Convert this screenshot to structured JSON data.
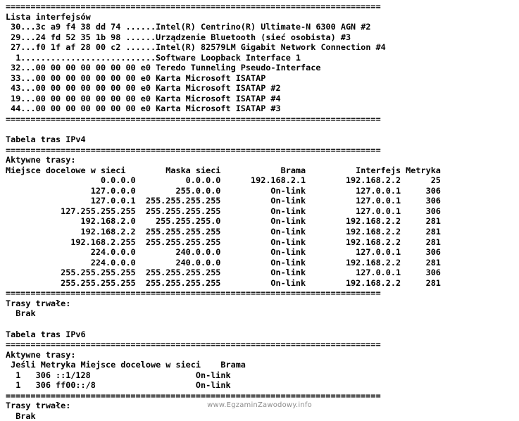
{
  "window": {
    "title": "route print",
    "background_color": "#ffffff",
    "text_color": "#000000"
  },
  "separator": "===========================================================================",
  "interface_list": {
    "heading": "Lista interfejsów",
    "rows": [
      {
        "id": "30",
        "mac": "...3c a9 f4 38 dd 74 ......",
        "name": "Intel(R) Centrino(R) Ultimate-N 6300 AGN #2"
      },
      {
        "id": "29",
        "mac": "...24 fd 52 35 1b 98 ......",
        "name": "Urządzenie Bluetooth (sieć osobista) #3"
      },
      {
        "id": "27",
        "mac": "...f0 1f af 28 00 c2 ......",
        "name": "Intel(R) 82579LM Gigabit Network Connection #4"
      },
      {
        "id": "1",
        "mac": "...........................",
        "name": "Software Loopback Interface 1"
      },
      {
        "id": "32",
        "mac": "...00 00 00 00 00 00 00 e0 ",
        "name": "Teredo Tunneling Pseudo-Interface"
      },
      {
        "id": "33",
        "mac": "...00 00 00 00 00 00 00 e0 ",
        "name": "Karta Microsoft ISATAP"
      },
      {
        "id": "43",
        "mac": "...00 00 00 00 00 00 00 e0 ",
        "name": "Karta Microsoft ISATAP #2"
      },
      {
        "id": "19",
        "mac": "...00 00 00 00 00 00 00 e0 ",
        "name": "Karta Microsoft ISATAP #4"
      },
      {
        "id": "44",
        "mac": "...00 00 00 00 00 00 00 e0 ",
        "name": "Karta Microsoft ISATAP #3"
      }
    ]
  },
  "ipv4": {
    "heading": "Tabela tras IPv4",
    "active_label": "Aktywne trasy:",
    "columns": [
      "Miejsce docelowe w sieci",
      "Maska sieci",
      "Brama",
      "Interfejs",
      "Metryka"
    ],
    "rows": [
      {
        "destination": "0.0.0.0",
        "netmask": "0.0.0.0",
        "gateway": "192.168.2.1",
        "interface": "192.168.2.2",
        "metric": "25"
      },
      {
        "destination": "127.0.0.0",
        "netmask": "255.0.0.0",
        "gateway": "On-link",
        "interface": "127.0.0.1",
        "metric": "306"
      },
      {
        "destination": "127.0.0.1",
        "netmask": "255.255.255.255",
        "gateway": "On-link",
        "interface": "127.0.0.1",
        "metric": "306"
      },
      {
        "destination": "127.255.255.255",
        "netmask": "255.255.255.255",
        "gateway": "On-link",
        "interface": "127.0.0.1",
        "metric": "306"
      },
      {
        "destination": "192.168.2.0",
        "netmask": "255.255.255.0",
        "gateway": "On-link",
        "interface": "192.168.2.2",
        "metric": "281"
      },
      {
        "destination": "192.168.2.2",
        "netmask": "255.255.255.255",
        "gateway": "On-link",
        "interface": "192.168.2.2",
        "metric": "281"
      },
      {
        "destination": "192.168.2.255",
        "netmask": "255.255.255.255",
        "gateway": "On-link",
        "interface": "192.168.2.2",
        "metric": "281"
      },
      {
        "destination": "224.0.0.0",
        "netmask": "240.0.0.0",
        "gateway": "On-link",
        "interface": "127.0.0.1",
        "metric": "306"
      },
      {
        "destination": "224.0.0.0",
        "netmask": "240.0.0.0",
        "gateway": "On-link",
        "interface": "192.168.2.2",
        "metric": "281"
      },
      {
        "destination": "255.255.255.255",
        "netmask": "255.255.255.255",
        "gateway": "On-link",
        "interface": "127.0.0.1",
        "metric": "306"
      },
      {
        "destination": "255.255.255.255",
        "netmask": "255.255.255.255",
        "gateway": "On-link",
        "interface": "192.168.2.2",
        "metric": "281"
      }
    ],
    "persistent_label": "Trasy trwałe:",
    "persistent_value": "Brak"
  },
  "ipv6": {
    "heading": "Tabela tras IPv6",
    "active_label": "Aktywne trasy:",
    "columns": [
      "Jeśli",
      "Metryka",
      "Miejsce docelowe w sieci",
      "Brama"
    ],
    "rows": [
      {
        "if": "1",
        "metric": "306",
        "destination": "::1/128",
        "gateway": "On-link"
      },
      {
        "if": "1",
        "metric": "306",
        "destination": "ff00::/8",
        "gateway": "On-link"
      }
    ],
    "persistent_label": "Trasy trwałe:",
    "persistent_value": "Brak"
  },
  "watermark": {
    "text": "www.EgzaminZawodowy.info"
  }
}
